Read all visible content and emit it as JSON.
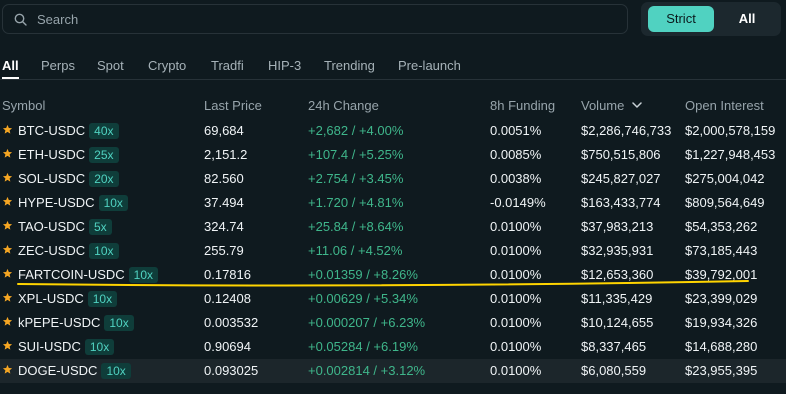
{
  "search": {
    "placeholder": "Search"
  },
  "toggle": {
    "strict": "Strict",
    "all": "All"
  },
  "tabs": [
    "All",
    "Perps",
    "Spot",
    "Crypto",
    "Tradfi",
    "HIP-3",
    "Trending",
    "Pre-launch"
  ],
  "columns": {
    "symbol": "Symbol",
    "last_price": "Last Price",
    "change": "24h Change",
    "funding": "8h Funding",
    "volume": "Volume",
    "open_interest": "Open Interest"
  },
  "rows": [
    {
      "symbol": "BTC-USDC",
      "leverage": "40x",
      "price": "69,684",
      "change": "+2,682 / +4.00%",
      "funding": "0.0051%",
      "volume": "$2,286,746,733",
      "oi": "$2,000,578,159"
    },
    {
      "symbol": "ETH-USDC",
      "leverage": "25x",
      "price": "2,151.2",
      "change": "+107.4 / +5.25%",
      "funding": "0.0085%",
      "volume": "$750,515,806",
      "oi": "$1,227,948,453"
    },
    {
      "symbol": "SOL-USDC",
      "leverage": "20x",
      "price": "82.560",
      "change": "+2.754 / +3.45%",
      "funding": "0.0038%",
      "volume": "$245,827,027",
      "oi": "$275,004,042"
    },
    {
      "symbol": "HYPE-USDC",
      "leverage": "10x",
      "price": "37.494",
      "change": "+1.720 / +4.81%",
      "funding": "-0.0149%",
      "volume": "$163,433,774",
      "oi": "$809,564,649"
    },
    {
      "symbol": "TAO-USDC",
      "leverage": "5x",
      "price": "324.74",
      "change": "+25.84 / +8.64%",
      "funding": "0.0100%",
      "volume": "$37,983,213",
      "oi": "$54,353,262"
    },
    {
      "symbol": "ZEC-USDC",
      "leverage": "10x",
      "price": "255.79",
      "change": "+11.06 / +4.52%",
      "funding": "0.0100%",
      "volume": "$32,935,931",
      "oi": "$73,185,443"
    },
    {
      "symbol": "FARTCOIN-USDC",
      "leverage": "10x",
      "price": "0.17816",
      "change": "+0.01359 / +8.26%",
      "funding": "0.0100%",
      "volume": "$12,653,360",
      "oi": "$39,792,001"
    },
    {
      "symbol": "XPL-USDC",
      "leverage": "10x",
      "price": "0.12408",
      "change": "+0.00629 / +5.34%",
      "funding": "0.0100%",
      "volume": "$11,335,429",
      "oi": "$23,399,029"
    },
    {
      "symbol": "kPEPE-USDC",
      "leverage": "10x",
      "price": "0.003532",
      "change": "+0.000207 / +6.23%",
      "funding": "0.0100%",
      "volume": "$10,124,655",
      "oi": "$19,934,326"
    },
    {
      "symbol": "SUI-USDC",
      "leverage": "10x",
      "price": "0.90694",
      "change": "+0.05284 / +6.19%",
      "funding": "0.0100%",
      "volume": "$8,337,465",
      "oi": "$14,688,280"
    },
    {
      "symbol": "DOGE-USDC",
      "leverage": "10x",
      "price": "0.093025",
      "change": "+0.002814 / +3.12%",
      "funding": "0.0100%",
      "volume": "$6,080,559",
      "oi": "$23,955,395"
    }
  ],
  "colors": {
    "accent": "#50d2c1",
    "positive": "#3fb68b",
    "star": "#f5a623",
    "annotation": "#ffd400"
  }
}
